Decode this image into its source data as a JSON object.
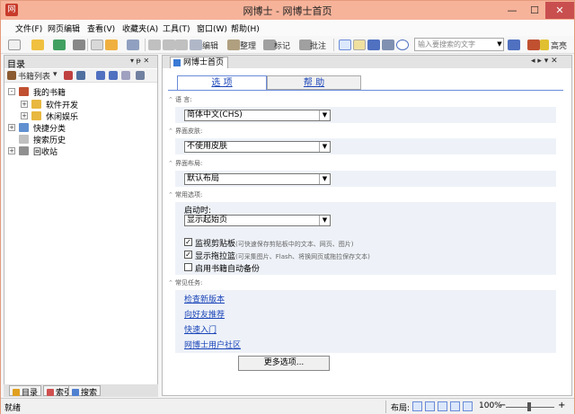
{
  "window": {
    "title": "网博士 - 网博士首页",
    "min_glyph": "—",
    "max_glyph": "☐",
    "close_glyph": "✕",
    "icon_glyph": "网"
  },
  "menu": [
    {
      "label": "文件(F)"
    },
    {
      "label": "网页编辑"
    },
    {
      "label": "查看(V)"
    },
    {
      "label": "收藏夹(A)"
    },
    {
      "label": "工具(T)"
    },
    {
      "label": "窗口(W)"
    },
    {
      "label": "帮助(H)"
    }
  ],
  "toolbar": {
    "edit_label": "编辑",
    "organize_label": "整理",
    "mark_label": "标记",
    "annotate_label": "批注",
    "search_placeholder": "输入要搜索的文字",
    "highlight_label": "高亮"
  },
  "left_panel": {
    "title": "目录",
    "pin_glyph": "▾ ᵽ ✕",
    "bookmark_list_label": "书籍列表",
    "tree": [
      {
        "label": "我的书籍",
        "level": 0,
        "expander": "-"
      },
      {
        "label": "软件开发",
        "level": 1,
        "expander": "+"
      },
      {
        "label": "休闲娱乐",
        "level": 1,
        "expander": "+"
      },
      {
        "label": "快捷分类",
        "level": 0,
        "expander": "+"
      },
      {
        "label": "搜索历史",
        "level": 0,
        "expander": ""
      },
      {
        "label": "回收站",
        "level": 0,
        "expander": "+"
      }
    ],
    "bottom_tabs": [
      {
        "label": "目录",
        "color": "#e0a020"
      },
      {
        "label": "索引",
        "color": "#d05050"
      },
      {
        "label": "搜索",
        "color": "#5080d0"
      }
    ]
  },
  "document": {
    "tab_label": "网博士首页",
    "ctrls": "◂ ▸ ▾ ✕",
    "inner_tabs": {
      "options": "选 项",
      "help": "帮 助"
    },
    "sections": {
      "language": {
        "title": "语 言:",
        "value": "简体中文(CHS)"
      },
      "skin": {
        "title": "界面皮肤:",
        "value": "不使用皮肤"
      },
      "layout": {
        "title": "界面布局:",
        "value": "默认布局"
      },
      "common": {
        "title": "常用选项:",
        "startup_label": "启动时:",
        "startup_value": "显示起始页",
        "checks": [
          {
            "label": "监视剪贴板",
            "hint": "(可快速保存剪贴板中的文本、网页、图片)",
            "checked": true,
            "mark": "✓"
          },
          {
            "label": "显示拖拉篮",
            "hint": "(可采集图片、Flash、将换网页或拖拉保存文本)",
            "checked": true,
            "mark": "✓"
          },
          {
            "label": "启用书籍自动备份",
            "hint": "",
            "checked": false,
            "mark": ""
          }
        ]
      },
      "tasks": {
        "title": "常见任务:",
        "links": [
          "检查新版本",
          "向好友推荐",
          "快速入门",
          "网博士用户社区"
        ]
      }
    },
    "more_button": "更多选项..."
  },
  "status": {
    "text": "就绪",
    "layout_label": "布局:",
    "zoom": "100%",
    "zoom_minus": "−",
    "zoom_plus": "+"
  },
  "colors": {
    "titlebar": "#f6b39a",
    "accent": "#6a8bd8",
    "link": "#1a44b8",
    "close": "#c94f4f"
  }
}
